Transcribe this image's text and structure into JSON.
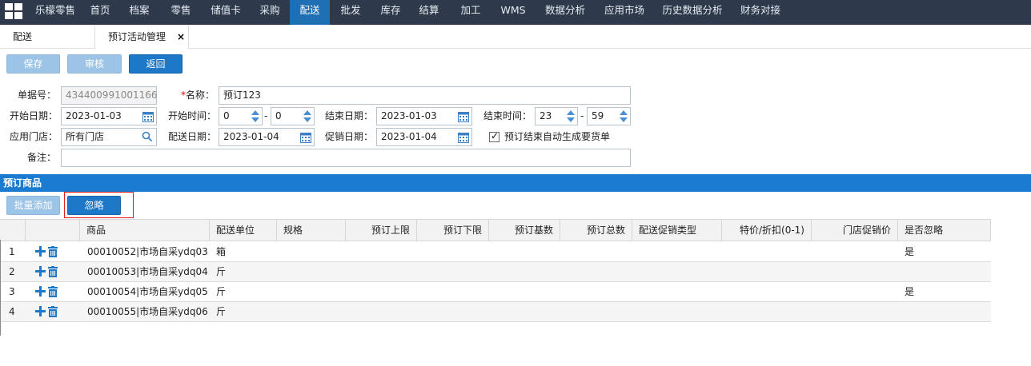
{
  "nav": {
    "items": [
      {
        "label": "乐檬零售",
        "active": false
      },
      {
        "label": "首页",
        "active": false
      },
      {
        "label": "档案",
        "active": false
      },
      {
        "label": "零售",
        "active": false
      },
      {
        "label": "储值卡",
        "active": false
      },
      {
        "label": "采购",
        "active": false
      },
      {
        "label": "配送",
        "active": true
      },
      {
        "label": "批发",
        "active": false
      },
      {
        "label": "库存",
        "active": false
      },
      {
        "label": "结算",
        "active": false
      },
      {
        "label": "加工",
        "active": false
      },
      {
        "label": "WMS",
        "active": false
      },
      {
        "label": "数据分析",
        "active": false
      },
      {
        "label": "应用市场",
        "active": false
      },
      {
        "label": "历史数据分析",
        "active": false
      },
      {
        "label": "财务对接",
        "active": false
      }
    ]
  },
  "tabs": {
    "home": "配送",
    "active": "预订活动管理",
    "close": "×"
  },
  "toolbar": {
    "save": "保存",
    "audit": "审核",
    "back": "返回"
  },
  "form": {
    "doc_no_label": "单据号：",
    "doc_no_value": "434400991001166",
    "name_label": "名称：",
    "name_required": "*",
    "name_value": "预订123",
    "start_date_label": "开始日期：",
    "start_date_value": "2023-01-03",
    "start_time_label": "开始时间：",
    "start_hour": "0",
    "start_minute": "0",
    "end_date_label": "结束日期：",
    "end_date_value": "2023-01-03",
    "end_time_label": "结束时间：",
    "end_hour": "23",
    "end_minute": "59",
    "time_sep": "-",
    "store_label": "应用门店：",
    "store_value": "所有门店",
    "delivery_date_label": "配送日期：",
    "delivery_date_value": "2023-01-04",
    "promo_date_label": "促销日期：",
    "promo_date_value": "2023-01-04",
    "auto_gen_label": "预订结束自动生成要货单",
    "auto_gen_checked": true,
    "remark_label": "备注：",
    "remark_value": ""
  },
  "section": {
    "title": "预订商品",
    "batch_add": "批量添加",
    "ignore": "忽略"
  },
  "grid": {
    "columns": [
      "商品",
      "配送单位",
      "规格",
      "预订上限",
      "预订下限",
      "预订基数",
      "预订总数",
      "配送促销类型",
      "特价/折扣(0-1)",
      "门店促销价",
      "是否忽略"
    ],
    "rows": [
      {
        "no": "1",
        "product": "00010052|市场自采ydq03",
        "unit": "箱",
        "ignored": "是"
      },
      {
        "no": "2",
        "product": "00010053|市场自采ydq04",
        "unit": "斤",
        "ignored": ""
      },
      {
        "no": "3",
        "product": "00010054|市场自采ydq05",
        "unit": "斤",
        "ignored": "是"
      },
      {
        "no": "4",
        "product": "00010055|市场自采ydq06",
        "unit": "斤",
        "ignored": ""
      }
    ]
  },
  "colors": {
    "nav_bg": "#2e3a4c",
    "accent": "#1e78c8",
    "highlight_outline": "#e02020"
  }
}
